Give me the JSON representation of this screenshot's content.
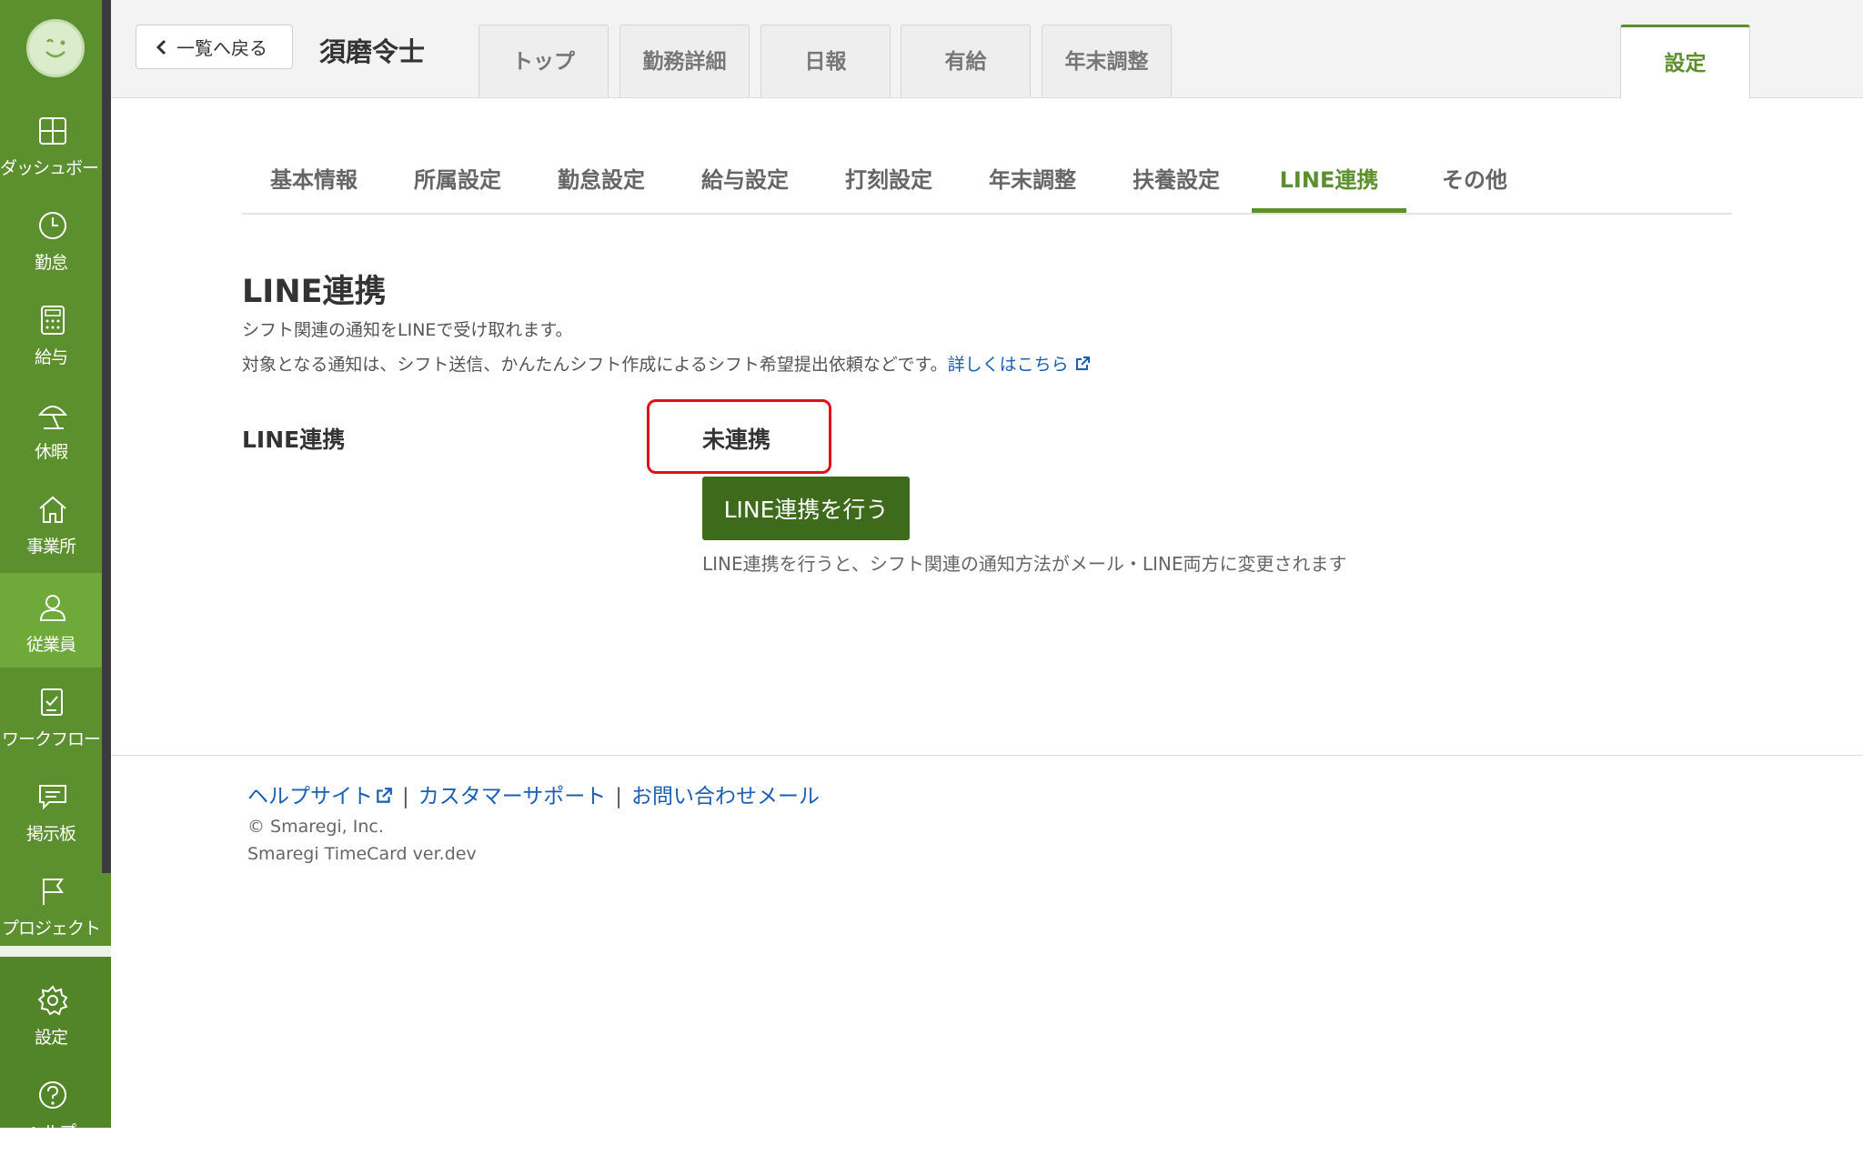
{
  "sidebar": {
    "items": [
      {
        "label": "ダッシュボード",
        "icon": "dashboard-icon"
      },
      {
        "label": "勤怠",
        "icon": "clock-icon"
      },
      {
        "label": "給与",
        "icon": "calculator-icon"
      },
      {
        "label": "休暇",
        "icon": "beach-umbrella-icon"
      },
      {
        "label": "事業所",
        "icon": "home-icon"
      },
      {
        "label": "従業員",
        "icon": "person-icon"
      },
      {
        "label": "ワークフロー",
        "icon": "checklist-icon"
      },
      {
        "label": "掲示板",
        "icon": "message-icon"
      },
      {
        "label": "プロジェクト",
        "icon": "flag-icon"
      },
      {
        "label": "設定",
        "icon": "gear-icon"
      },
      {
        "label": "ヘルプ",
        "icon": "help-icon"
      }
    ],
    "active": "従業員"
  },
  "header": {
    "back_label": "一覧へ戻る",
    "employee_name": "須磨令士",
    "tabs": [
      "トップ",
      "勤務詳細",
      "日報",
      "有給",
      "年末調整",
      "設定"
    ],
    "active_tab": "設定"
  },
  "subtabs": {
    "items": [
      "基本情報",
      "所属設定",
      "勤怠設定",
      "給与設定",
      "打刻設定",
      "年末調整",
      "扶養設定",
      "LINE連携",
      "その他"
    ],
    "active": "LINE連携"
  },
  "content": {
    "title": "LINE連携",
    "desc1": "シフト関連の通知をLINEで受け取れます。",
    "desc2": "対象となる通知は、シフト送信、かんたんシフト作成によるシフト希望提出依頼などです。",
    "desc2_link": "詳しくはこちら",
    "field_label": "LINE連携",
    "status": "未連携",
    "button_label": "LINE連携を行う",
    "button_note": "LINE連携を行うと、シフト関連の通知方法がメール・LINE両方に変更されます"
  },
  "footer": {
    "help_site": "ヘルプサイト",
    "customer_support": "カスタマーサポート",
    "contact_mail": "お問い合わせメール",
    "copyright": "© Smaregi, Inc.",
    "version": "Smaregi TimeCard ver.dev"
  },
  "colors": {
    "brand_green": "#5c8f2e",
    "button_dark_green": "#3e6a1c",
    "highlight_red": "#e0101a",
    "link_blue": "#1a5fb4"
  }
}
